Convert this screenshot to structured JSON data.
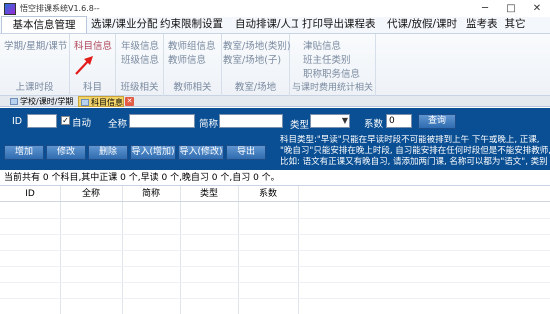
{
  "window": {
    "title": "悟空排课系统V1.6.8--",
    "minimize": "─",
    "maximize": "□",
    "close": "✕"
  },
  "menu": {
    "tabs": [
      {
        "label": "基本信息管理",
        "active": true
      },
      {
        "label": "选课/课业分配"
      },
      {
        "label": "约束限制设置"
      },
      {
        "label": "自动排课/人工调"
      },
      {
        "label": "打印导出课程表"
      },
      {
        "label": "代课/放假/课时"
      },
      {
        "label": "监考表"
      },
      {
        "label": "其它"
      }
    ]
  },
  "ribbon": {
    "groups": [
      {
        "label": "上课时段",
        "items": [
          "学期/星期/课节"
        ]
      },
      {
        "label": "科目",
        "items": [
          "科目信息"
        ]
      },
      {
        "label": "班级相关",
        "items": [
          "年级信息",
          "班级信息"
        ]
      },
      {
        "label": "教师相关",
        "items": [
          "教师组信息",
          "教师信息"
        ]
      },
      {
        "label": "教室/场地",
        "items": [
          "教室/场地(类别)",
          "教室/场地(子)"
        ]
      },
      {
        "label": "与课时费用统计相关",
        "items": [
          "津贴信息",
          "班主任类别",
          "职称职务信息"
        ]
      }
    ]
  },
  "doc_tabs": [
    {
      "label": "学校/课时/学期"
    },
    {
      "label": "科目信息",
      "active": true
    }
  ],
  "doc_tab_close": "✕",
  "filter": {
    "id_label": "ID",
    "auto_label": "自动",
    "auto_checked": "✓",
    "fullname_label": "全称",
    "shortname_label": "简称",
    "type_label": "类型",
    "type_arrow": "▼",
    "coef_label": "系数",
    "coef_value": "0",
    "query_button": "查询"
  },
  "actions": [
    "增加",
    "修改",
    "删除",
    "导入(增加)",
    "导入(修改)",
    "导出"
  ],
  "info_lines": [
    "科目类型:\"早读\"只能在早读时段不可能被排到上午 下午或晚上, 正课,",
    "\"晚自习\"只能安排在晚上时段, 自习能安排在任何时段但是不能安排教师,",
    "比如: 语文有正课又有晚自习, 请添加两门课, 名称可以都为\"语文\", 类别"
  ],
  "status": "当前共有 0 个科目,其中正课 0 个,早读 0 个,晚自习 0 个,自习 0 个。",
  "table": {
    "columns": [
      "ID",
      "全称",
      "简称",
      "类型",
      "系数"
    ]
  }
}
